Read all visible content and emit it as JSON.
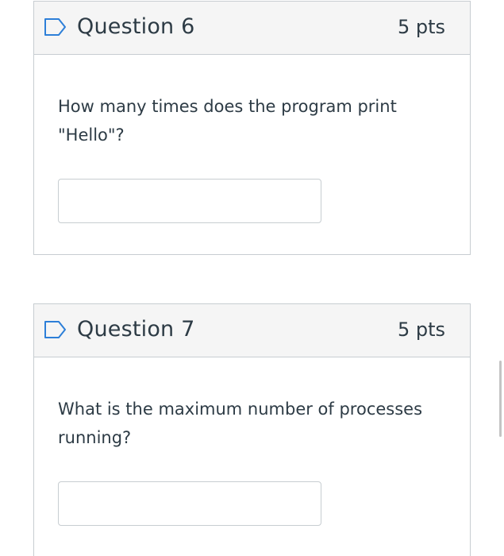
{
  "questions": [
    {
      "title": "Question 6",
      "points": "5 pts",
      "text": "How many times does the program print \"Hello\"?",
      "answer_value": ""
    },
    {
      "title": "Question 7",
      "points": "5 pts",
      "text": "What is the maximum number of processes running?",
      "answer_value": ""
    }
  ],
  "icons": {
    "flag": "flag-outline-icon"
  },
  "colors": {
    "accent": "#2d7fd8",
    "text": "#2d3b45",
    "header_bg": "#f5f5f5",
    "border": "#c7cdd1"
  }
}
